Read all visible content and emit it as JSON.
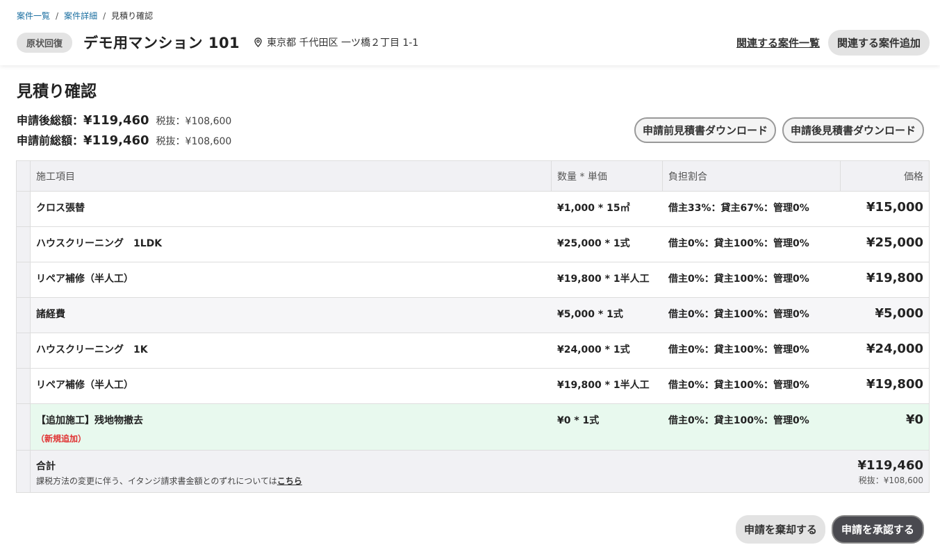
{
  "breadcrumb": {
    "items": [
      "案件一覧",
      "案件詳細"
    ],
    "separator": "/",
    "current": "見積り確認"
  },
  "header": {
    "badge": "原状回復",
    "property_name": "デモ用マンション 101",
    "address": "東京都 千代田区 一ツ橋２丁目 1-1",
    "related_list_link": "関連する案件一覧",
    "related_add_button": "関連する案件追加"
  },
  "page": {
    "title": "見積り確認",
    "after_total_label": "申請後総額：",
    "after_total_value": "¥119,460",
    "after_total_tax": "税抜：¥108,600",
    "before_total_label": "申請前総額：",
    "before_total_value": "¥119,460",
    "before_total_tax": "税抜：¥108,600",
    "download_before": "申請前見積書ダウンロード",
    "download_after": "申請後見積書ダウンロード"
  },
  "table": {
    "headers": {
      "item": "施工項目",
      "qty": "数量 * 単価",
      "ratio": "負担割合",
      "price": "価格"
    },
    "rows": [
      {
        "item": "クロス張替",
        "qty": "¥1,000 * 15㎡",
        "ratio": "借主33%：貸主67%：管理0%",
        "price": "¥15,000"
      },
      {
        "item": "ハウスクリーニング　1LDK",
        "qty": "¥25,000 * 1式",
        "ratio": "借主0%：貸主100%：管理0%",
        "price": "¥25,000"
      },
      {
        "item": "リペア補修（半人工）",
        "qty": "¥19,800 * 1半人工",
        "ratio": "借主0%：貸主100%：管理0%",
        "price": "¥19,800"
      },
      {
        "item": "諸経費",
        "qty": "¥5,000 * 1式",
        "ratio": "借主0%：貸主100%：管理0%",
        "price": "¥5,000"
      },
      {
        "item": "ハウスクリーニング　1K",
        "qty": "¥24,000 * 1式",
        "ratio": "借主0%：貸主100%：管理0%",
        "price": "¥24,000"
      },
      {
        "item": "リペア補修（半人工）",
        "qty": "¥19,800 * 1半人工",
        "ratio": "借主0%：貸主100%：管理0%",
        "price": "¥19,800"
      },
      {
        "item": "【追加施工】残地物撤去",
        "tag": "（新規追加）",
        "qty": "¥0 * 1式",
        "ratio": "借主0%：貸主100%：管理0%",
        "price": "¥0"
      }
    ],
    "summary": {
      "label": "合計",
      "note": "課税方法の変更に伴う、イタンジ請求書金額とのずれについては",
      "note_link": "こちら",
      "total": "¥119,460",
      "tax": "税抜：¥108,600"
    }
  },
  "footer": {
    "reject_button": "申請を棄却する",
    "approve_button": "申請を承認する"
  },
  "colors": {
    "link": "#1a6ea0",
    "new_row_bg": "#e8f9ee",
    "new_tag": "#e03030",
    "approve_bg": "#4a4a50"
  }
}
